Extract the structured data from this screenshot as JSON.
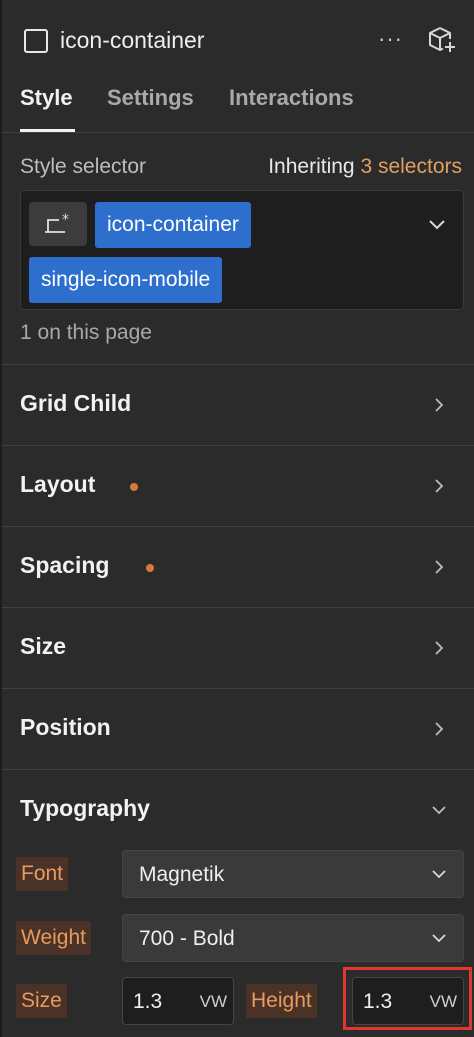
{
  "header": {
    "element_name": "icon-container",
    "more_icon": "more-horizontal-icon",
    "component_icon": "cube-plus-icon"
  },
  "tabs": [
    {
      "label": "Style",
      "active": true
    },
    {
      "label": "Settings",
      "active": false
    },
    {
      "label": "Interactions",
      "active": false
    }
  ],
  "selector": {
    "label": "Style selector",
    "inheriting_prefix": "Inheriting",
    "inheriting_count": "3 selectors",
    "chips": [
      "icon-container",
      "single-icon-mobile"
    ],
    "on_page": "1 on this page"
  },
  "sections": [
    {
      "title": "Grid Child",
      "modified": false
    },
    {
      "title": "Layout",
      "modified": true
    },
    {
      "title": "Spacing",
      "modified": true
    },
    {
      "title": "Size",
      "modified": false
    },
    {
      "title": "Position",
      "modified": false
    },
    {
      "title": "Typography",
      "expanded": true
    }
  ],
  "typography": {
    "font_label": "Font",
    "font_value": "Magnetik",
    "weight_label": "Weight",
    "weight_value": "700 - Bold",
    "size_label": "Size",
    "size_value": "1.3",
    "size_unit": "VW",
    "height_label": "Height",
    "height_value": "1.3",
    "height_unit": "VW"
  },
  "colors": {
    "accent_blue": "#2e6fce",
    "modified_dot": "#d97a3c",
    "inherit_orange": "#e0a060",
    "highlight_red": "#e0392b"
  }
}
